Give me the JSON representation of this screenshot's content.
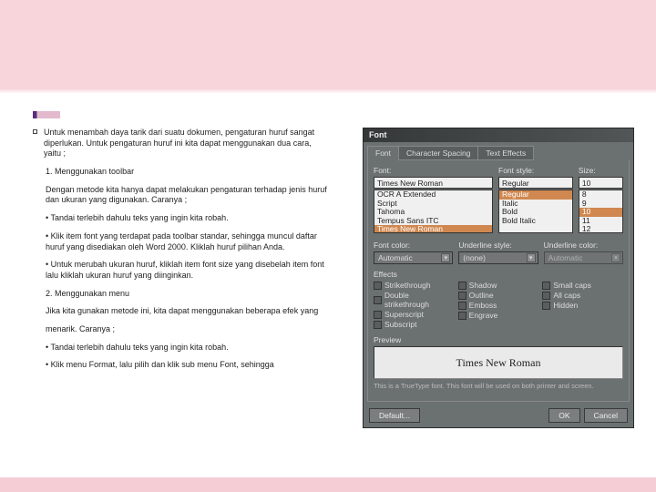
{
  "content": {
    "intro": "Untuk menambah daya tarik dari suatu dokumen, pengaturan huruf sangat diperlukan. Untuk pengaturan huruf ini kita dapat menggunakan dua cara, yaitu ;",
    "p1": "1. Menggunakan toolbar",
    "p2": "Dengan metode kita hanya dapat melakukan pengaturan terhadap jenis huruf dan ukuran yang digunakan. Caranya ;",
    "p3": "• Tandai terlebih dahulu teks yang ingin kita robah.",
    "p4": "• Klik item font yang terdapat pada toolbar standar, sehingga muncul daftar huruf yang disediakan oleh Word 2000. Kliklah huruf pilihan Anda.",
    "p5": "• Untuk merubah ukuran huruf, kliklah item font size yang disebelah item font lalu kliklah ukuran huruf yang diinginkan.",
    "p6": "2. Menggunakan menu",
    "p7": "Jika kita gunakan metode ini, kita dapat menggunakan beberapa efek yang",
    "p8": "menarik. Caranya ;",
    "p9": "• Tandai terlebih dahulu teks yang ingin kita robah.",
    "p10": "• Klik menu Format, lalu pilih dan klik sub menu Font, sehingga"
  },
  "dialog": {
    "title": "Font",
    "tabs": {
      "t1": "Font",
      "t2": "Character Spacing",
      "t3": "Text Effects"
    },
    "labels": {
      "font": "Font:",
      "style": "Font style:",
      "size": "Size:",
      "color": "Font color:",
      "uline": "Underline style:",
      "ucolor": "Underline color:",
      "effects": "Effects",
      "preview": "Preview"
    },
    "font_value": "Times New Roman",
    "font_list": [
      "OCR A Extended",
      "Script",
      "Tahoma",
      "Tempus Sans ITC",
      "Times New Roman"
    ],
    "style_value": "Regular",
    "style_list": [
      "Regular",
      "Italic",
      "Bold",
      "Bold Italic"
    ],
    "size_value": "10",
    "size_list": [
      "8",
      "9",
      "10",
      "11",
      "12"
    ],
    "color_value": "Automatic",
    "uline_value": "(none)",
    "ucolor_value": "Automatic",
    "effects_col1": [
      "Strikethrough",
      "Double strikethrough",
      "Superscript",
      "Subscript"
    ],
    "effects_col2": [
      "Shadow",
      "Outline",
      "Emboss",
      "Engrave"
    ],
    "effects_col3": [
      "Small caps",
      "All caps",
      "Hidden"
    ],
    "preview_text": "Times New Roman",
    "hint": "This is a TrueType font. This font will be used on both printer and screen.",
    "btn_default": "Default...",
    "btn_ok": "OK",
    "btn_cancel": "Cancel"
  }
}
